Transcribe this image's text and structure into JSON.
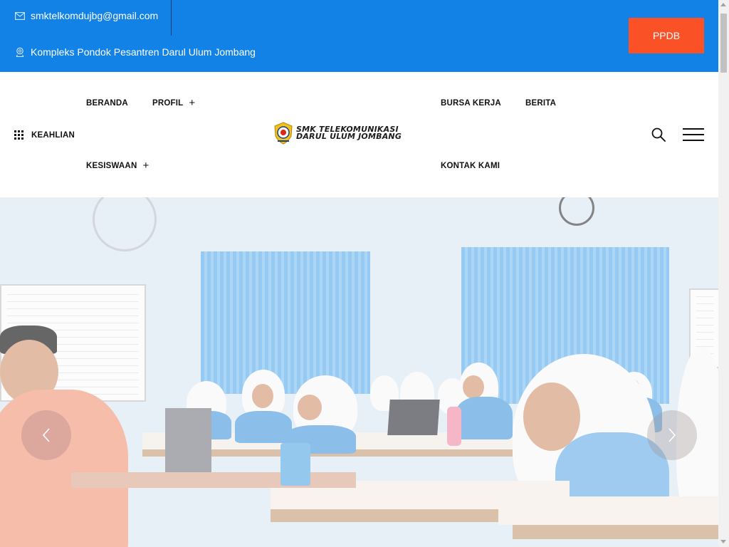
{
  "topbar": {
    "email": "smktelkomdujbg@gmail.com",
    "address": "Kompleks Pondok Pesantren Darul Ulum Jombang",
    "cta_label": "PPDB",
    "bg_color": "#1282e6",
    "cta_color": "#fb5127",
    "icons": {
      "email": "envelope-icon",
      "address": "location-pin-icon"
    }
  },
  "nav": {
    "keahlian": "KEAHLIAN",
    "beranda": "BERANDA",
    "profil": "PROFIL",
    "kesiswaan": "KESISWAAN",
    "bursa_kerja": "BURSA KERJA",
    "berita": "BERITA",
    "kontak_kami": "KONTAK KAMI",
    "submenu_indicator": "+",
    "icons": {
      "keahlian": "grid-icon",
      "search": "search-icon",
      "menu": "hamburger-menu-icon"
    }
  },
  "logo": {
    "line1": "SMK TELEKOMUNIKASI",
    "line2": "DARUL ULUM JOMBANG",
    "emblem": "school-emblem-icon"
  },
  "hero": {
    "image": "classroom-photo",
    "prev_icon": "chevron-left-icon",
    "next_icon": "chevron-right-icon"
  }
}
